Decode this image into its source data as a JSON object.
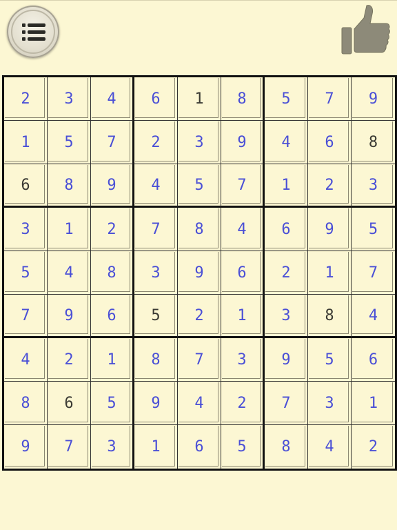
{
  "toolbar": {
    "menu_icon": "list-menu-icon",
    "thumbs_icon": "thumbs-up-icon"
  },
  "colors": {
    "background": "#fcf7d3",
    "entered_digit": "#4a4fd6",
    "given_digit": "#3a3a33",
    "grid_line": "#111111",
    "thumb": "#8d8a79"
  },
  "board": {
    "rows": [
      [
        "2",
        "3",
        "4",
        "6",
        "1",
        "8",
        "5",
        "7",
        "9"
      ],
      [
        "1",
        "5",
        "7",
        "2",
        "3",
        "9",
        "4",
        "6",
        "8"
      ],
      [
        "6",
        "8",
        "9",
        "4",
        "5",
        "7",
        "1",
        "2",
        "3"
      ],
      [
        "3",
        "1",
        "2",
        "7",
        "8",
        "4",
        "6",
        "9",
        "5"
      ],
      [
        "5",
        "4",
        "8",
        "3",
        "9",
        "6",
        "2",
        "1",
        "7"
      ],
      [
        "7",
        "9",
        "6",
        "5",
        "2",
        "1",
        "3",
        "8",
        "4"
      ],
      [
        "4",
        "2",
        "1",
        "8",
        "7",
        "3",
        "9",
        "5",
        "6"
      ],
      [
        "8",
        "6",
        "5",
        "9",
        "4",
        "2",
        "7",
        "3",
        "1"
      ],
      [
        "9",
        "7",
        "3",
        "1",
        "6",
        "5",
        "8",
        "4",
        "2"
      ]
    ],
    "given": [
      [
        0,
        0,
        0,
        0,
        1,
        0,
        0,
        0,
        0
      ],
      [
        0,
        0,
        0,
        0,
        0,
        0,
        0,
        0,
        1
      ],
      [
        1,
        0,
        0,
        0,
        0,
        0,
        0,
        0,
        0
      ],
      [
        0,
        0,
        0,
        0,
        0,
        0,
        0,
        0,
        0
      ],
      [
        0,
        0,
        0,
        0,
        0,
        0,
        0,
        0,
        0
      ],
      [
        0,
        0,
        0,
        1,
        0,
        0,
        0,
        1,
        0
      ],
      [
        0,
        0,
        0,
        0,
        0,
        0,
        0,
        0,
        0
      ],
      [
        0,
        1,
        0,
        0,
        0,
        0,
        0,
        0,
        0
      ],
      [
        0,
        0,
        0,
        0,
        0,
        0,
        0,
        0,
        0
      ]
    ]
  }
}
